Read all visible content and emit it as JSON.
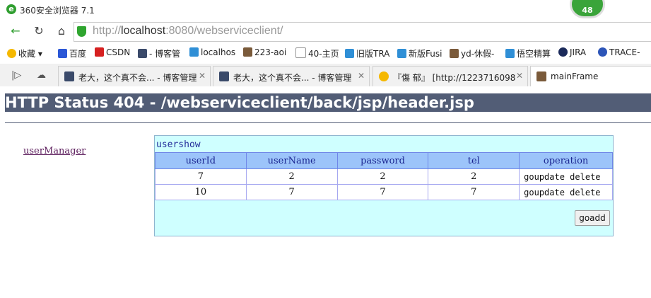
{
  "browser": {
    "title": "360安全浏览器 7.1",
    "badge": "48",
    "url_protocol": "http://",
    "url_host": "localhost",
    "url_rest": ":8080/webserviceclient/",
    "bookmarks": [
      "收藏",
      "百度",
      "CSDN",
      "- 博客管",
      "localhos",
      "223-aoi",
      "40-主页",
      "旧版TRA",
      "新版Fusi",
      "yd-休假-",
      "悟空精算",
      "JIRA",
      "TRACE-"
    ],
    "tabs": [
      "老大，这个真不会... - 博客管理",
      "老大，这个真不会... - 博客管理",
      "『傷 郁』 [http://1223716098",
      "mainFrame"
    ]
  },
  "page": {
    "error_heading": "HTTP Status 404 - /webserviceclient/back/jsp/header.jsp",
    "left_link": "userManager",
    "panel_caption": "usershow",
    "columns": [
      "userId",
      "userName",
      "password",
      "tel",
      "operation"
    ],
    "rows": [
      {
        "id": "7",
        "name": "2",
        "password": "2",
        "tel": "2",
        "op1": "goupdate",
        "op2": "delete"
      },
      {
        "id": "10",
        "name": "7",
        "password": "7",
        "tel": "7",
        "op1": "goupdate",
        "op2": "delete"
      }
    ],
    "add_button": "goadd"
  },
  "colors": {
    "error_bar": "#525d76",
    "panel_bg": "#cfffff",
    "header_bg": "#9cc4fa"
  }
}
